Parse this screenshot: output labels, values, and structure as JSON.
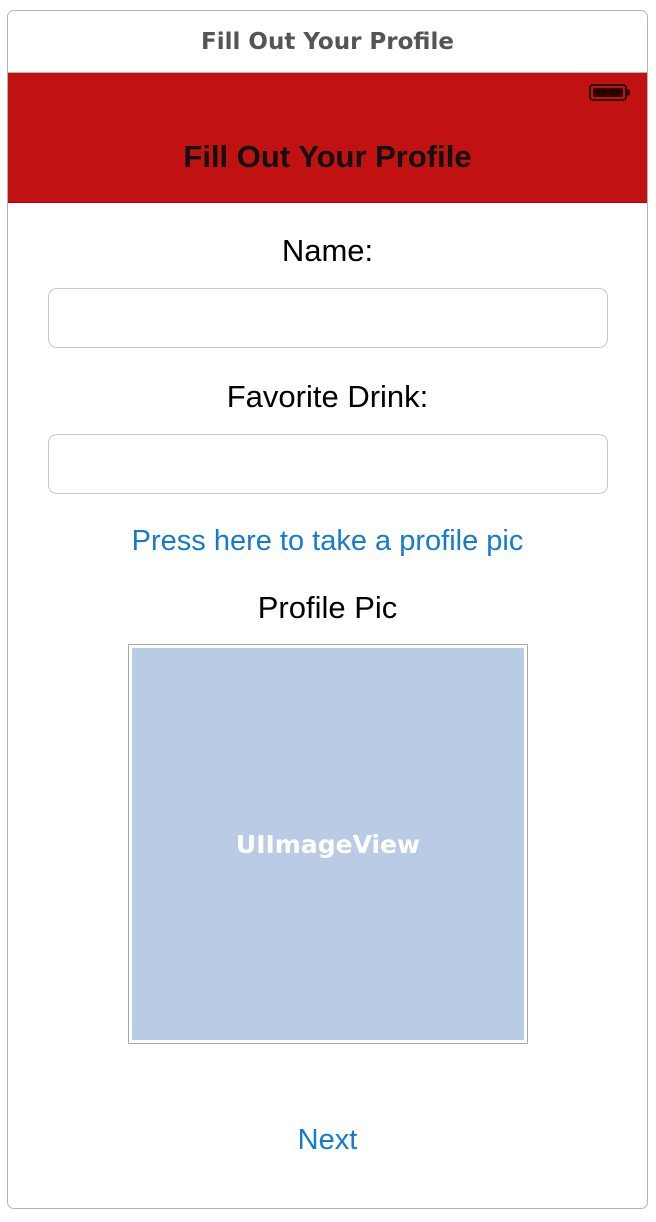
{
  "scene": {
    "title": "Fill Out Your Profile"
  },
  "nav_bar": {
    "title": "Fill Out Your Profile",
    "color": "#c11111"
  },
  "form": {
    "name_label": "Name:",
    "name_value": "",
    "drink_label": "Favorite Drink:",
    "drink_value": "",
    "take_pic_label": "Press here to take a profile pic",
    "profile_pic_label": "Profile Pic",
    "image_placeholder": "UIImageView",
    "next_label": "Next"
  },
  "colors": {
    "link": "#147bd1",
    "image_fill": "#bacbe5"
  },
  "icons": {
    "status": "battery-icon"
  }
}
